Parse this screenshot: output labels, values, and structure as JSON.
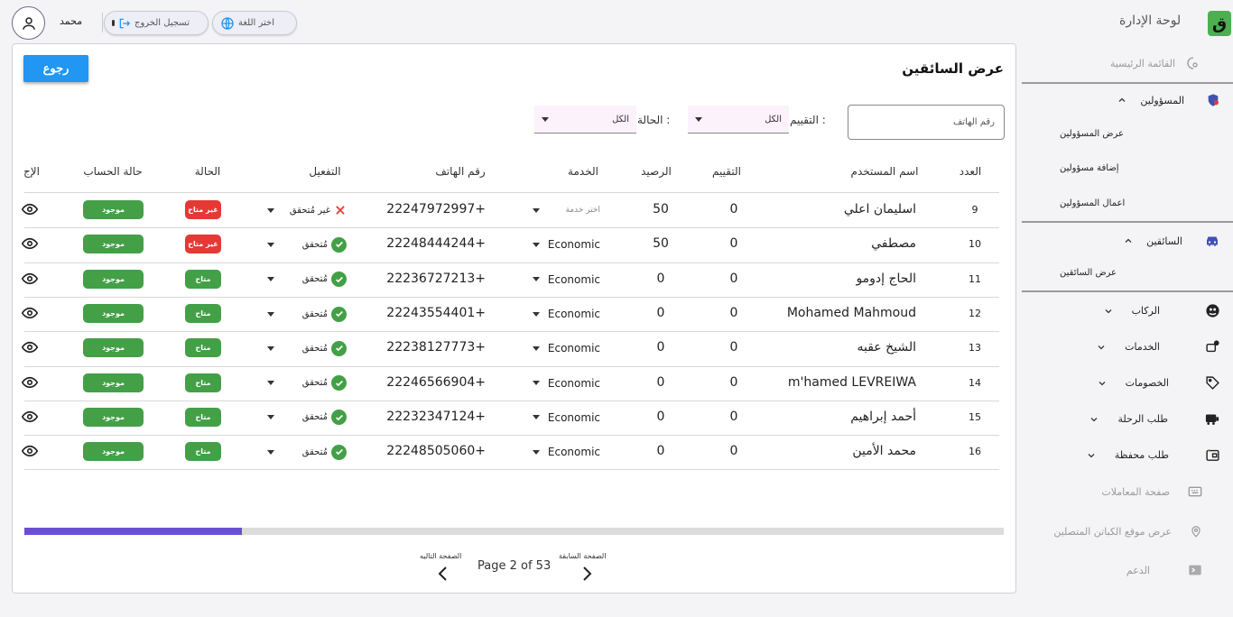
{
  "header": {
    "username": "محمد",
    "logout_label": "تسجيل الخروج",
    "lang_label": "اختر اللغة"
  },
  "sidebar": {
    "title": "لوحة الإدارة",
    "logo_char": "ق",
    "home": "القائمة الرئيسية",
    "admins": "المسؤولين",
    "admins_sub": [
      "عرض المسؤولين",
      "إضافة مسؤولين",
      "اعمال المسؤولين"
    ],
    "drivers": "السائقين",
    "drivers_sub": [
      "عرض السائقين"
    ],
    "riders": "الركاب",
    "services": "الخدمات",
    "discounts": "الخصومات",
    "trip_request": "طلب الرحلة",
    "wallet_request": "طلب محفظة",
    "transactions": "صفحة المعاملات",
    "connected_map": "عرض موقع الكباتن المتصلين",
    "support": "الدعم"
  },
  "main": {
    "title": "عرض السائقين",
    "back_label": "رجوع",
    "phone_placeholder": "رقم الهاتف",
    "rating_label": "التقييم :",
    "rating_value": "الكل",
    "status_label": "الحالة :",
    "status_value": "الكل"
  },
  "table": {
    "headers": {
      "count": "العدد",
      "username": "اسم المستخدم",
      "rating": "التقييم",
      "balance": "الرصيد",
      "service": "الخدمة",
      "phone": "رقم الهاتف",
      "activation": "التفعيل",
      "status": "الحالة",
      "account": "حالة الحساب",
      "actions": "الإج"
    },
    "rows": [
      {
        "count": "9",
        "name": "اسليمان اعلي",
        "rating": "0",
        "balance": "50",
        "service": "اختر خدمة",
        "phone": "22247972997+",
        "activation": "غير مُتحقق",
        "status": "غير متاح",
        "account": "موجود"
      },
      {
        "count": "10",
        "name": "مصطفي",
        "rating": "0",
        "balance": "50",
        "service": "Economic",
        "phone": "22248444244+",
        "activation": "مُتحقق",
        "status": "غير متاح",
        "account": "موجود"
      },
      {
        "count": "11",
        "name": "الحاج إدومو",
        "rating": "0",
        "balance": "0",
        "service": "Economic",
        "phone": "22236727213+",
        "activation": "مُتحقق",
        "status": "متاح",
        "account": "موجود"
      },
      {
        "count": "12",
        "name": "Mohamed Mahmoud",
        "rating": "0",
        "balance": "0",
        "service": "Economic",
        "phone": "22243554401+",
        "activation": "مُتحقق",
        "status": "متاح",
        "account": "موجود"
      },
      {
        "count": "13",
        "name": "الشيخ عقبه",
        "rating": "0",
        "balance": "0",
        "service": "Economic",
        "phone": "22238127773+",
        "activation": "مُتحقق",
        "status": "متاح",
        "account": "موجود"
      },
      {
        "count": "14",
        "name": "m'hamed LEVREIWA",
        "rating": "0",
        "balance": "0",
        "service": "Economic",
        "phone": "22246566904+",
        "activation": "مُتحقق",
        "status": "متاح",
        "account": "موجود"
      },
      {
        "count": "15",
        "name": "أحمد إبراهيم",
        "rating": "0",
        "balance": "0",
        "service": "Economic",
        "phone": "22232347124+",
        "activation": "مُتحقق",
        "status": "متاح",
        "account": "موجود"
      },
      {
        "count": "16",
        "name": "محمد الأمين",
        "rating": "0",
        "balance": "0",
        "service": "Economic",
        "phone": "22248505060+",
        "activation": "مُتحقق",
        "status": "متاح",
        "account": "موجود"
      }
    ]
  },
  "pagination": {
    "prev_label": "الصفحة السابقة",
    "next_label": "الصفحة التاليه",
    "page_info": "Page 2 of 53"
  },
  "colors": {
    "primary": "#2196f3",
    "success": "#43a047",
    "danger": "#e53935",
    "scroll_thumb": "#6a4fd6"
  }
}
